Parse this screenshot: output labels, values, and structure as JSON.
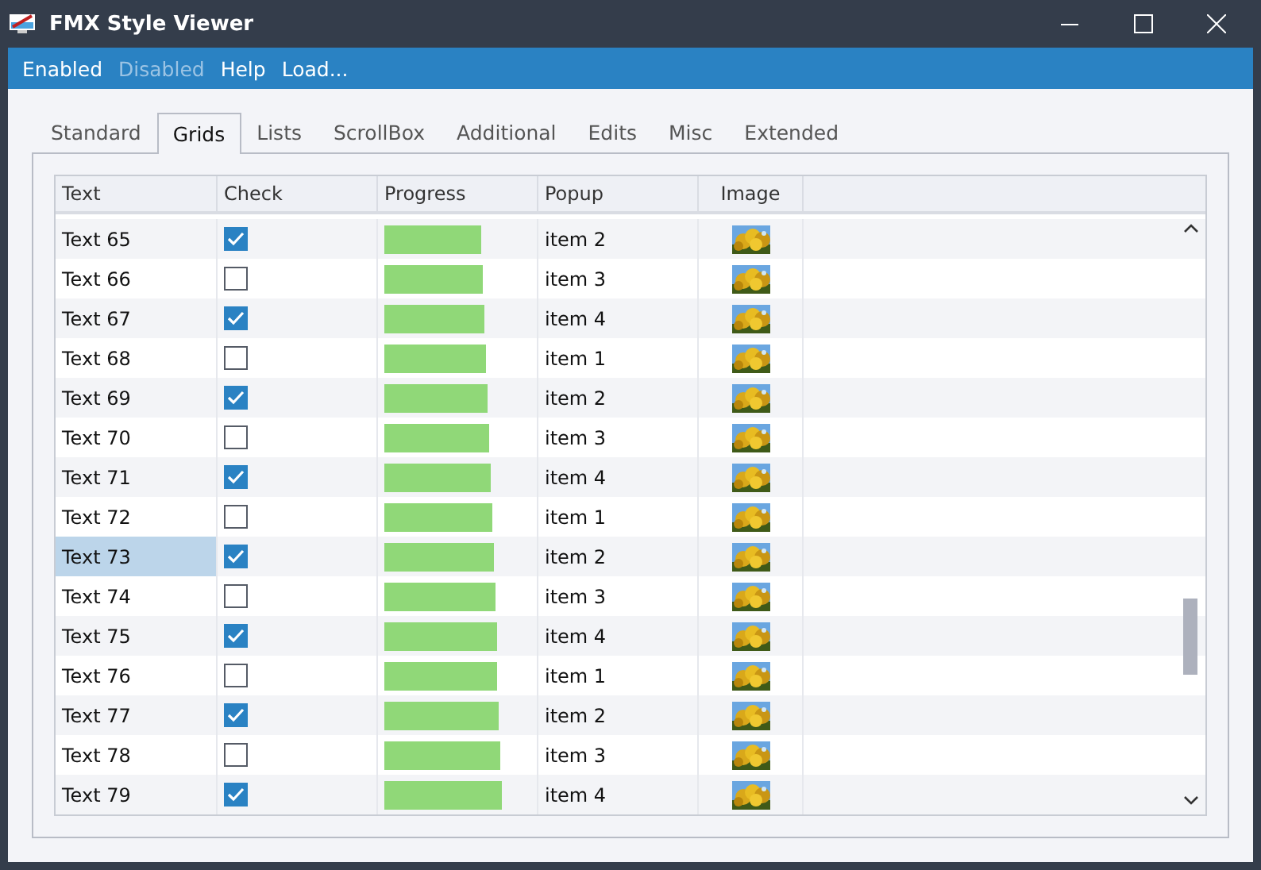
{
  "window": {
    "title": "FMX Style Viewer"
  },
  "menu": [
    {
      "label": "Enabled",
      "disabled": false
    },
    {
      "label": "Disabled",
      "disabled": true
    },
    {
      "label": "Help",
      "disabled": false
    },
    {
      "label": "Load...",
      "disabled": false
    }
  ],
  "tabs": [
    {
      "label": "Standard",
      "selected": false
    },
    {
      "label": "Grids",
      "selected": true
    },
    {
      "label": "Lists",
      "selected": false
    },
    {
      "label": "ScrollBox",
      "selected": false
    },
    {
      "label": "Additional",
      "selected": false
    },
    {
      "label": "Edits",
      "selected": false
    },
    {
      "label": "Misc",
      "selected": false
    },
    {
      "label": "Extended",
      "selected": false
    }
  ],
  "grid": {
    "columns": [
      "Text",
      "Check",
      "Progress",
      "Popup",
      "Image"
    ],
    "rows": [
      {
        "text": "Text 65",
        "checked": true,
        "level": 0.65,
        "popup": "item 2",
        "selected": false
      },
      {
        "text": "Text 66",
        "checked": false,
        "level": 0.66,
        "popup": "item 3",
        "selected": false
      },
      {
        "text": "Text 67",
        "checked": true,
        "level": 0.67,
        "popup": "item 4",
        "selected": false
      },
      {
        "text": "Text 68",
        "checked": false,
        "level": 0.68,
        "popup": "item 1",
        "selected": false
      },
      {
        "text": "Text 69",
        "checked": true,
        "level": 0.69,
        "popup": "item 2",
        "selected": false
      },
      {
        "text": "Text 70",
        "checked": false,
        "level": 0.7,
        "popup": "item 3",
        "selected": false
      },
      {
        "text": "Text 71",
        "checked": true,
        "level": 0.71,
        "popup": "item 4",
        "selected": false
      },
      {
        "text": "Text 72",
        "checked": false,
        "level": 0.72,
        "popup": "item 1",
        "selected": false
      },
      {
        "text": "Text 73",
        "checked": true,
        "level": 0.73,
        "popup": "item 2",
        "selected": true
      },
      {
        "text": "Text 74",
        "checked": false,
        "level": 0.74,
        "popup": "item 3",
        "selected": false
      },
      {
        "text": "Text 75",
        "checked": true,
        "level": 0.75,
        "popup": "item 4",
        "selected": false
      },
      {
        "text": "Text 76",
        "checked": false,
        "level": 0.76,
        "popup": "item 1",
        "selected": false
      },
      {
        "text": "Text 77",
        "checked": true,
        "level": 0.77,
        "popup": "item 2",
        "selected": false
      },
      {
        "text": "Text 78",
        "checked": false,
        "level": 0.78,
        "popup": "item 3",
        "selected": false
      },
      {
        "text": "Text 79",
        "checked": true,
        "level": 0.79,
        "popup": "item 4",
        "selected": false
      }
    ]
  }
}
